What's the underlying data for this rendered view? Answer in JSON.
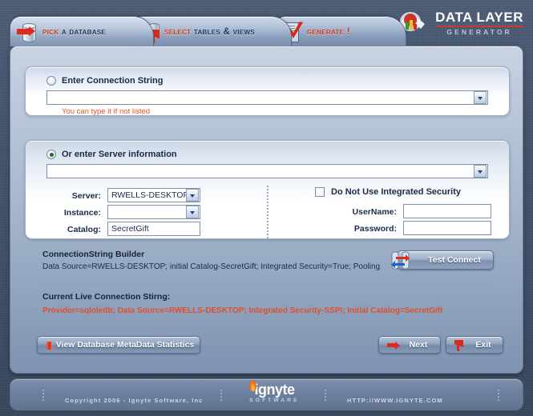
{
  "app": {
    "brand_title": "DATA LAYER",
    "brand_sub": "GENERATOR",
    "brand_icon": "data-layer-logo-icon"
  },
  "tabs": [
    {
      "highlight": "Pick",
      "rest": " a database",
      "icon": "database-arrow-icon",
      "active": true
    },
    {
      "highlight": "Select",
      "rest": " Tables & Views",
      "icon": "database-flag-icon",
      "active": false
    },
    {
      "highlight": "Generate !",
      "rest": "",
      "icon": "clipboard-check-icon",
      "active": false
    }
  ],
  "connection_string_group": {
    "radio_label": "Enter Connection String",
    "radio_checked": false,
    "combo_value": "",
    "combo_icon": "chevron-down-icon",
    "hint": "You can type it if not listed"
  },
  "server_group": {
    "radio_label": "Or enter Server information",
    "radio_checked": true,
    "combo_value": "",
    "combo_icon": "chevron-down-icon",
    "fields": {
      "server_label": "Server:",
      "server_value": "RWELLS-DESKTOP",
      "instance_label": "Instance:",
      "instance_value": "",
      "catalog_label": "Catalog:",
      "catalog_value": "SecretGift"
    },
    "security": {
      "checkbox_label": "Do Not Use Integrated Security",
      "checkbox_checked": false,
      "username_label": "UserName:",
      "username_value": "",
      "password_label": "Password:",
      "password_value": ""
    }
  },
  "builder": {
    "title": "ConnectionString Builder",
    "body": "Data Source=RWELLS-DESKTOP; initial Catalog-SecretGift; Integrated Security=True; Pooling",
    "live_title": "Current Live Connection Stirng:",
    "live_value": "Provider=sqloledb; Data Source=RWELLS-DESKTOP; Integrated Security-SSPI; Initial Catalog=SecretGift",
    "test_button": "Test Connect",
    "test_icon": "sync-database-icon"
  },
  "actions": {
    "metadata_button": "View Database MetaData Statistics",
    "metadata_icon": "database-mini-icon",
    "next_button": "Next",
    "next_icon": "arrow-right-icon",
    "exit_button": "Exit",
    "exit_icon": "flag-icon"
  },
  "footer": {
    "copyright": "Copyright 2006 - Ignyte Software, Inc",
    "logo_word": "ignyte",
    "logo_sub": "SOFTWARE",
    "url": "HTTP://WWW.IGNYTE.COM"
  },
  "colors": {
    "accent_red": "#e2502a",
    "tab_highlight": "#d93b16",
    "text_dark": "#1b2b47",
    "panel_bg": "#a7b7cd",
    "window_bg": "#41506a"
  }
}
